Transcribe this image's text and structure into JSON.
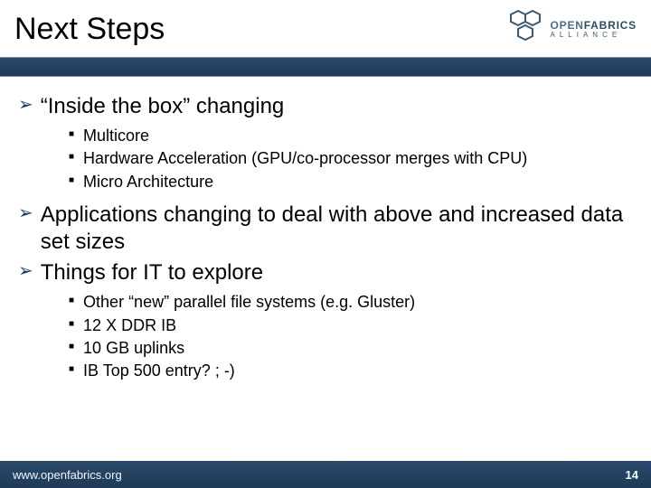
{
  "header": {
    "title": "Next Steps",
    "logo": {
      "line1a": "OPEN",
      "line1b": "FABRICS",
      "line2": "ALLIANCE"
    }
  },
  "content": {
    "bullets": [
      {
        "text": "“Inside the box” changing",
        "sub": [
          "Multicore",
          "Hardware Acceleration (GPU/co-processor merges with CPU)",
          "Micro Architecture"
        ]
      },
      {
        "text": "Applications changing to deal with above and increased data set sizes",
        "sub": []
      },
      {
        "text": "Things for IT to explore",
        "sub": [
          "Other “new” parallel file systems (e.g. Gluster)",
          "12 X DDR IB",
          "10 GB uplinks",
          "IB Top 500 entry? ; -)"
        ]
      }
    ]
  },
  "footer": {
    "url": "www.openfabrics.org",
    "page": "14"
  }
}
